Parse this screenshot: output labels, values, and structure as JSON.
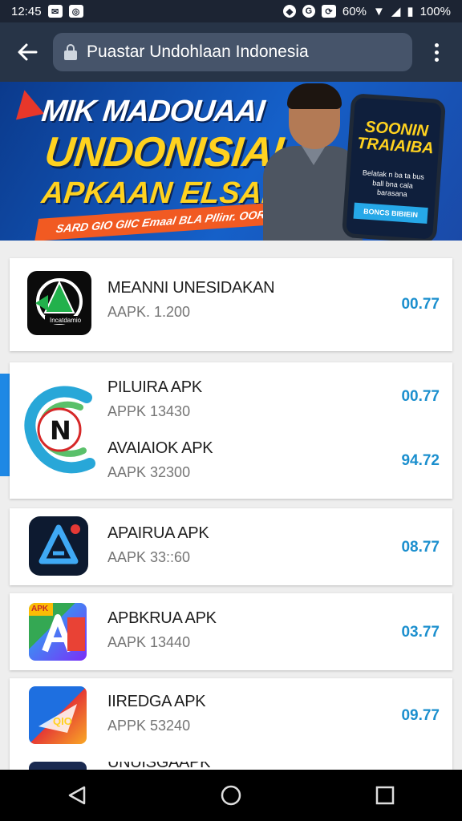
{
  "status_bar": {
    "time": "12:45",
    "right_text": "60%",
    "battery": "100%"
  },
  "browser": {
    "url_text": "Puastar Undohlaan Indonesia"
  },
  "banner": {
    "line1": "MIK MADOUAAI",
    "line2": "UNDONISIAI",
    "line3": "APKAAN ELSANG",
    "ribbon": "SARD GIO GIIC Emaal BLA Pllinr. OORK",
    "phone_title": "SOONIN TRAIAIBA",
    "phone_sub": "Belatak n ba ta bus ball bna cala barasana",
    "phone_button": "BONCS BIBIEIN"
  },
  "apps": [
    {
      "name": "MEANNI UNESIDAKAN",
      "sub": "AAPK. 1.200",
      "value": "00.77",
      "icon": "recycle-arrow-icon",
      "icon_text": "Incatdamio"
    },
    {
      "name": "PILUIRA APK",
      "sub": "APPK 13430",
      "value": "00.77",
      "icon": "n-swirl-icon"
    },
    {
      "name": "AVAIAIOK APK",
      "sub": "AAPK 32300",
      "value": "94.72"
    },
    {
      "name": "APAIRUA APK",
      "sub": "AAPK 33::60",
      "value": "08.77",
      "icon": "triangle-a-icon"
    },
    {
      "name": "APBKRUA APK",
      "sub": "AAPK 13440",
      "value": "03.77",
      "icon": "apk-letter-a-icon",
      "icon_text": "APK"
    },
    {
      "name": "IIREDGA APK",
      "sub": "APPK 53240",
      "value": "09.77",
      "icon": "plane-card-icon",
      "icon_text": "QIO"
    },
    {
      "name": "UNUISGAAPK",
      "icon": "partial-app-icon"
    }
  ],
  "colors": {
    "accent": "#1b8fce",
    "app_bar": "#273447",
    "banner_yellow": "#ffd21f"
  }
}
